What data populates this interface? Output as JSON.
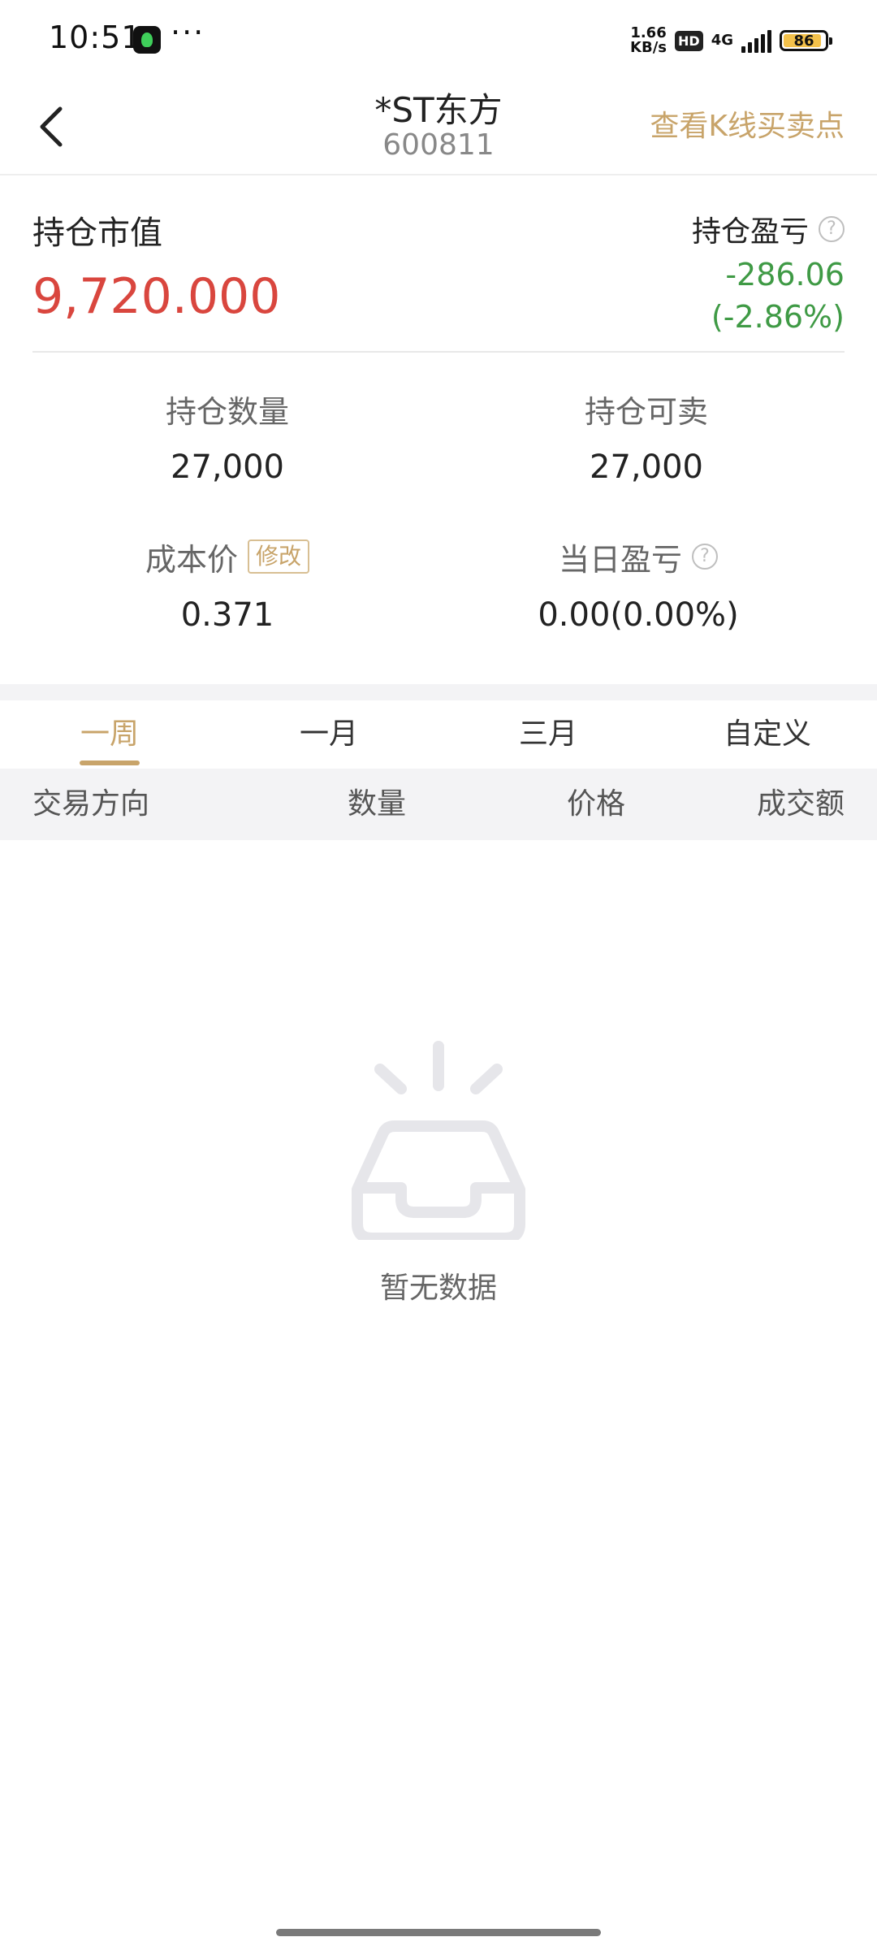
{
  "status_bar": {
    "time": "10:51",
    "dots": "···",
    "net_speed_value": "1.66",
    "net_speed_unit": "KB/s",
    "hd": "HD",
    "network": "4G",
    "battery": "86"
  },
  "nav": {
    "title": "*ST东方",
    "code": "600811",
    "action": "查看K线买卖点",
    "back_icon": "chevron-left-icon"
  },
  "summary": {
    "market_value_label": "持仓市值",
    "market_value": "9,720.000",
    "pl_label": "持仓盈亏",
    "pl_value": "-286.06",
    "pl_percent": "(-2.86%)",
    "help_icon": "help-circle-icon"
  },
  "stats": {
    "quantity_label": "持仓数量",
    "quantity_value": "27,000",
    "sellable_label": "持仓可卖",
    "sellable_value": "27,000",
    "cost_label": "成本价",
    "cost_edit": "修改",
    "cost_value": "0.371",
    "daily_pl_label": "当日盈亏",
    "daily_pl_value": "0.00(0.00%)"
  },
  "tabs": [
    {
      "label": "一周",
      "active": true
    },
    {
      "label": "一月",
      "active": false
    },
    {
      "label": "三月",
      "active": false
    },
    {
      "label": "自定义",
      "active": false
    }
  ],
  "table": {
    "columns": [
      "交易方向",
      "数量",
      "价格",
      "成交额"
    ],
    "rows": []
  },
  "empty_state": {
    "icon": "inbox-empty-icon",
    "text": "暂无数据"
  },
  "colors": {
    "accent_gold": "#c8a46a",
    "red": "#d9463e",
    "green": "#3f9a45"
  }
}
